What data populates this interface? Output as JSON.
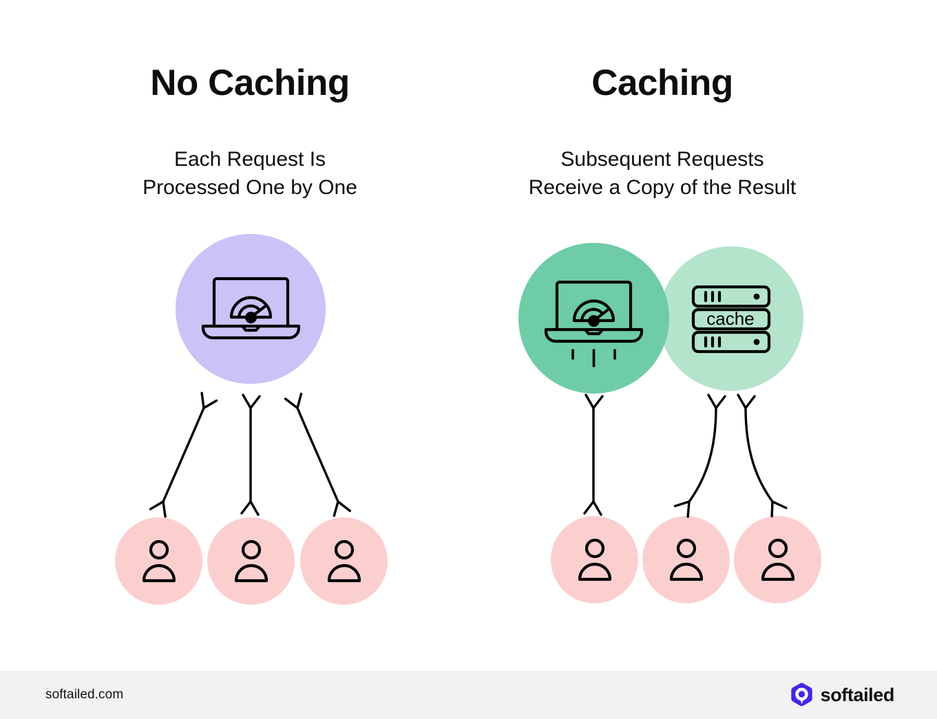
{
  "palette": {
    "background": "#ffffff",
    "footer_background": "#f2f2f2",
    "text": "#0d0d0d",
    "stroke": "#000000",
    "lavender": "#cbc2f8",
    "green_dark": "#6ecca6",
    "green_light": "#b4e4cb",
    "pink": "#fccfcf",
    "brand_purple": "#4326e8"
  },
  "columns": [
    {
      "id": "no-caching",
      "title": "No Caching",
      "subtitle_line1": "Each Request Is",
      "subtitle_line2": "Processed One by One",
      "server": {
        "icon": "laptop-speedometer-icon",
        "circle_color": "#cbc2f8",
        "label": ""
      },
      "users": [
        {
          "icon": "user-icon",
          "circle_color": "#fccfcf"
        },
        {
          "icon": "user-icon",
          "circle_color": "#fccfcf"
        },
        {
          "icon": "user-icon",
          "circle_color": "#fccfcf"
        }
      ],
      "connectors": [
        {
          "name": "connector-left",
          "style": "curved-double-arrow"
        },
        {
          "name": "connector-middle",
          "style": "straight-double-arrow"
        },
        {
          "name": "connector-right",
          "style": "curved-double-arrow"
        }
      ]
    },
    {
      "id": "caching",
      "title": "Caching",
      "subtitle_line1": "Subsequent Requests",
      "subtitle_line2": "Receive a Copy of the Result",
      "server": {
        "icon": "laptop-speedometer-fast-icon",
        "circle_color": "#6ecca6",
        "label": ""
      },
      "cache": {
        "icon": "cache-server-icon",
        "circle_color": "#b4e4cb",
        "label": "cache"
      },
      "users": [
        {
          "icon": "user-icon",
          "circle_color": "#fccfcf"
        },
        {
          "icon": "user-icon",
          "circle_color": "#fccfcf"
        },
        {
          "icon": "user-icon",
          "circle_color": "#fccfcf"
        }
      ],
      "connectors": [
        {
          "name": "connector-origin",
          "style": "straight-double-arrow"
        },
        {
          "name": "connector-cache-left",
          "style": "curved-double-arrow"
        },
        {
          "name": "connector-cache-right",
          "style": "curved-double-arrow"
        }
      ]
    }
  ],
  "footer": {
    "url": "softailed.com",
    "brand_name": "softailed",
    "brand_mark": "softailed-logo-icon"
  }
}
